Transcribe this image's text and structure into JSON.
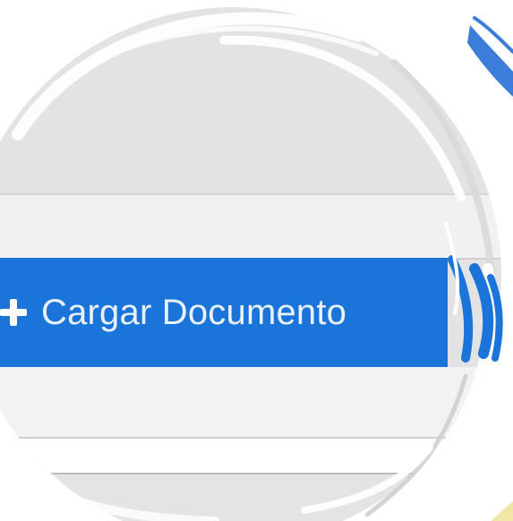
{
  "upload_button": {
    "label": "Cargar Documento",
    "icon": "plus-icon"
  },
  "colors": {
    "accent": "#1a74d9",
    "background": "#e3e3e3",
    "brush_accent": "#3b7dd8"
  }
}
